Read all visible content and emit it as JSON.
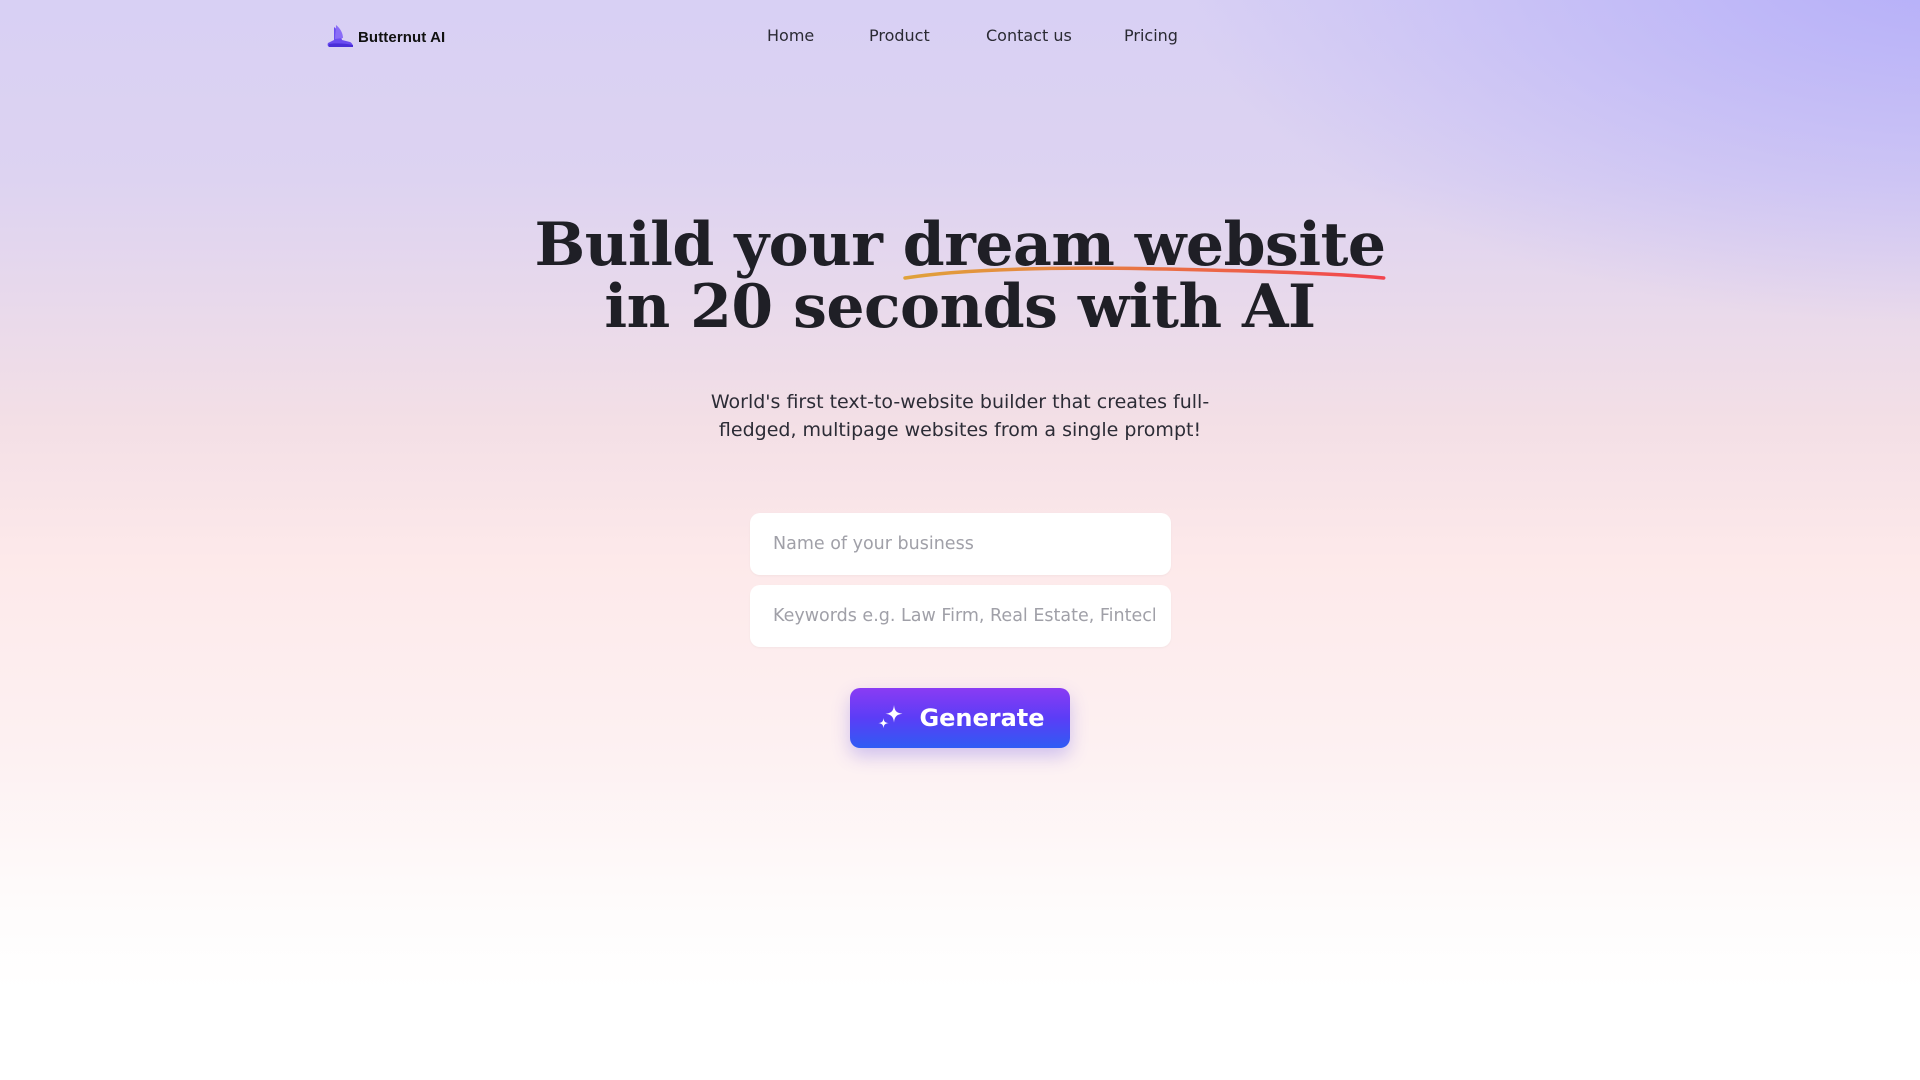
{
  "brand": {
    "name": "Butternut AI",
    "logo_icon": "layered-wave-logo-icon",
    "logo_color": "#5b3df6"
  },
  "nav": {
    "items": [
      {
        "label": "Home"
      },
      {
        "label": "Product"
      },
      {
        "label": "Contact us"
      },
      {
        "label": "Pricing"
      }
    ]
  },
  "hero": {
    "headline_prefix": "Build your ",
    "headline_highlight": "dream website",
    "headline_line2": "in 20 seconds with AI",
    "underline_colors": [
      "#e0a23a",
      "#f2454e"
    ],
    "subtitle_line1": "World's first text-to-website builder that creates full-",
    "subtitle_line2": "fledged, multipage websites from a single prompt!"
  },
  "form": {
    "business_name": {
      "value": "",
      "placeholder": "Name of your business"
    },
    "keywords": {
      "value": "",
      "placeholder": "Keywords e.g. Law Firm, Real Estate, Fintech S"
    },
    "generate_label": "Generate",
    "generate_icon": "sparkle-icon",
    "button_gradient": [
      "#8a3cf4",
      "#2f5cf4"
    ]
  }
}
